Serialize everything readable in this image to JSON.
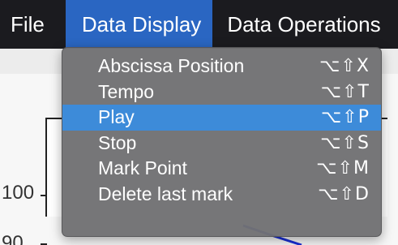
{
  "menubar": {
    "items": [
      {
        "label": "File"
      },
      {
        "label": "Data Display"
      },
      {
        "label": "Data Operations"
      }
    ]
  },
  "dropdown": {
    "items": [
      {
        "label": "Abscissa Position",
        "shortcut": "⌥⇧X"
      },
      {
        "label": "Tempo",
        "shortcut": "⌥⇧T"
      },
      {
        "label": "Play",
        "shortcut": "⌥⇧P",
        "highlighted": true
      },
      {
        "label": "Stop",
        "shortcut": "⌥⇧S"
      },
      {
        "label": "Mark Point",
        "shortcut": "⌥⇧M"
      },
      {
        "label": "Delete last mark",
        "shortcut": "⌥⇧D"
      }
    ]
  },
  "plot": {
    "tick_labels": [
      "100",
      "90"
    ]
  },
  "colors": {
    "menubar_bg": "#1b1b1f",
    "menubar_active": "#2a66c2",
    "menu_bg": "#707072",
    "menu_highlight": "#3d8bd9",
    "series_line": "#1a2fd6"
  }
}
